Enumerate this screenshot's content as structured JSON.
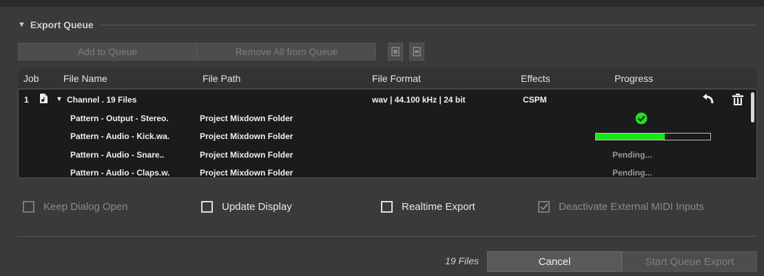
{
  "section": {
    "title": "Export Queue"
  },
  "toolbar": {
    "add_label": "Add to Queue",
    "remove_all_label": "Remove All from Queue",
    "icon1": "expand-all-icon",
    "icon2": "collapse-all-icon"
  },
  "table": {
    "columns": [
      "Job",
      "File Name",
      "File Path",
      "File Format",
      "Effects",
      "Progress"
    ],
    "job": {
      "number": "1",
      "icon": "audio-file-icon",
      "name": "Channel . 19 Files",
      "format": "wav | 44.100 kHz | 24 bit",
      "effects": "CSPM",
      "actions": [
        "undo-icon",
        "trash-icon"
      ]
    },
    "files": [
      {
        "name": "Pattern - Output - Stereo.",
        "path": "Project Mixdown Folder",
        "status": "done",
        "status_text": ""
      },
      {
        "name": "Pattern - Audio - Kick.wa.",
        "path": "Project Mixdown Folder",
        "status": "progress",
        "progress": 0.6,
        "status_text": ""
      },
      {
        "name": "Pattern - Audio - Snare..",
        "path": "Project Mixdown Folder",
        "status": "pending",
        "status_text": "Pending..."
      },
      {
        "name": "Pattern - Audio - Claps.w.",
        "path": "Project Mixdown Folder",
        "status": "pending",
        "status_text": "Pending..."
      }
    ]
  },
  "options": {
    "keep_dialog_open": {
      "label": "Keep Dialog Open",
      "checked": false,
      "enabled": false
    },
    "update_display": {
      "label": "Update Display",
      "checked": false,
      "enabled": true
    },
    "realtime_export": {
      "label": "Realtime Export",
      "checked": false,
      "enabled": true
    },
    "deactivate_midi": {
      "label": "Deactivate External MIDI Inputs",
      "checked": true,
      "enabled": false
    }
  },
  "footer": {
    "files_count": "19 Files",
    "cancel_label": "Cancel",
    "start_label": "Start Queue Export"
  },
  "colors": {
    "progress": "#19e619",
    "done_check": "#22dd22"
  }
}
